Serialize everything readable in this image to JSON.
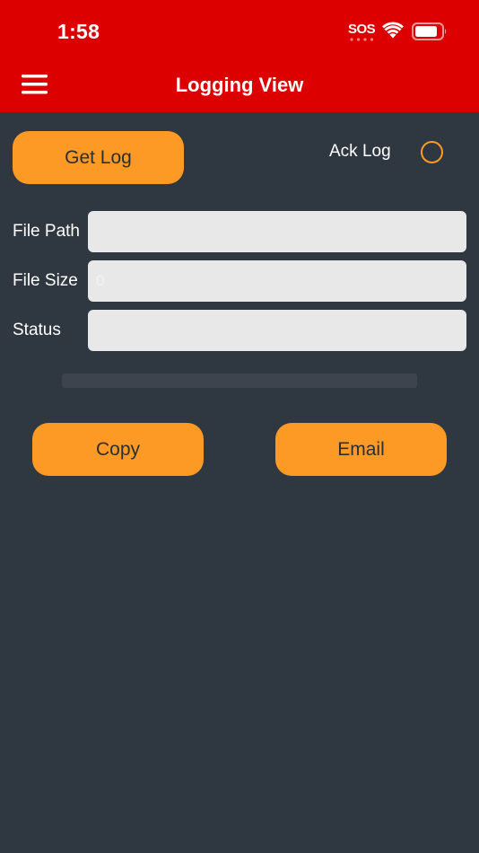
{
  "status_bar": {
    "time": "1:58",
    "sos": "SOS",
    "icons": [
      "wifi-icon",
      "battery-icon"
    ]
  },
  "nav": {
    "title": "Logging View",
    "menu_icon": "hamburger-menu-icon"
  },
  "controls": {
    "get_log_label": "Get Log",
    "ack_log_label": "Ack Log",
    "ack_log_checked": false
  },
  "fields": {
    "file_path": {
      "label": "File Path",
      "value": "",
      "placeholder": ""
    },
    "file_size": {
      "label": "File Size",
      "value": "",
      "placeholder": "0"
    },
    "status": {
      "label": "Status",
      "value": "",
      "placeholder": ""
    }
  },
  "progress": {
    "value": 0
  },
  "actions": {
    "copy_label": "Copy",
    "email_label": "Email"
  },
  "colors": {
    "header_red": "#dd0000",
    "background": "#2f3740",
    "accent_orange": "#fd9a25"
  }
}
